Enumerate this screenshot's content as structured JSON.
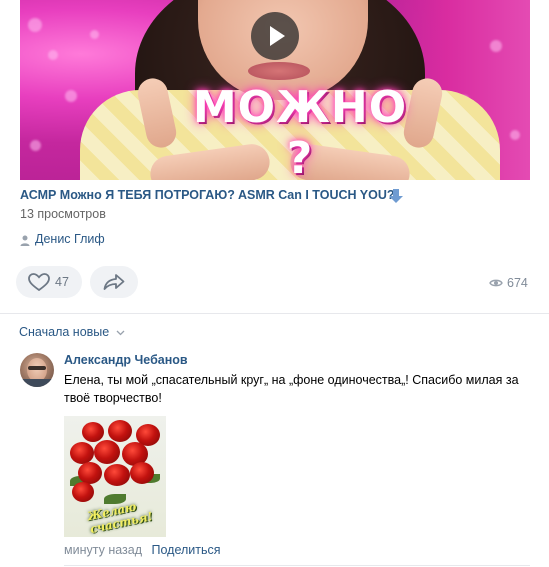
{
  "video": {
    "thumbnail_caption": "МОЖНО ?",
    "title": "АСМР Можно Я ТЕБЯ ПОТРОГАЮ?",
    "title_en": "ASMR Can I TOUCH YOU?",
    "views": "13 просмотров",
    "author": "Денис Глиф"
  },
  "actions": {
    "likes": "47",
    "views_count": "674"
  },
  "comments": {
    "sort_label": "Сначала новые",
    "items": [
      {
        "author": "Александр Чебанов",
        "text": "Елена, ты мой „спасательный круг„ на „фоне одиночества„! Спасибо милая за твоё творчество!",
        "image_caption": "Желаю счастья!",
        "time": "минуту назад",
        "share_label": "Поделиться"
      }
    ]
  },
  "colors": {
    "link": "#2a5885",
    "secondary_text": "#656565",
    "button_bg": "#f0f2f5",
    "icon": "#6d7885",
    "download_arrow": "#6f9bd1",
    "thumbnail_pink": "#e83fbf"
  },
  "icons": {
    "play": "play-icon",
    "download": "arrow-down-icon",
    "author": "user-icon",
    "like": "heart-icon",
    "share": "share-arrow-icon",
    "views": "eye-icon",
    "sort": "chevron-down-icon"
  }
}
